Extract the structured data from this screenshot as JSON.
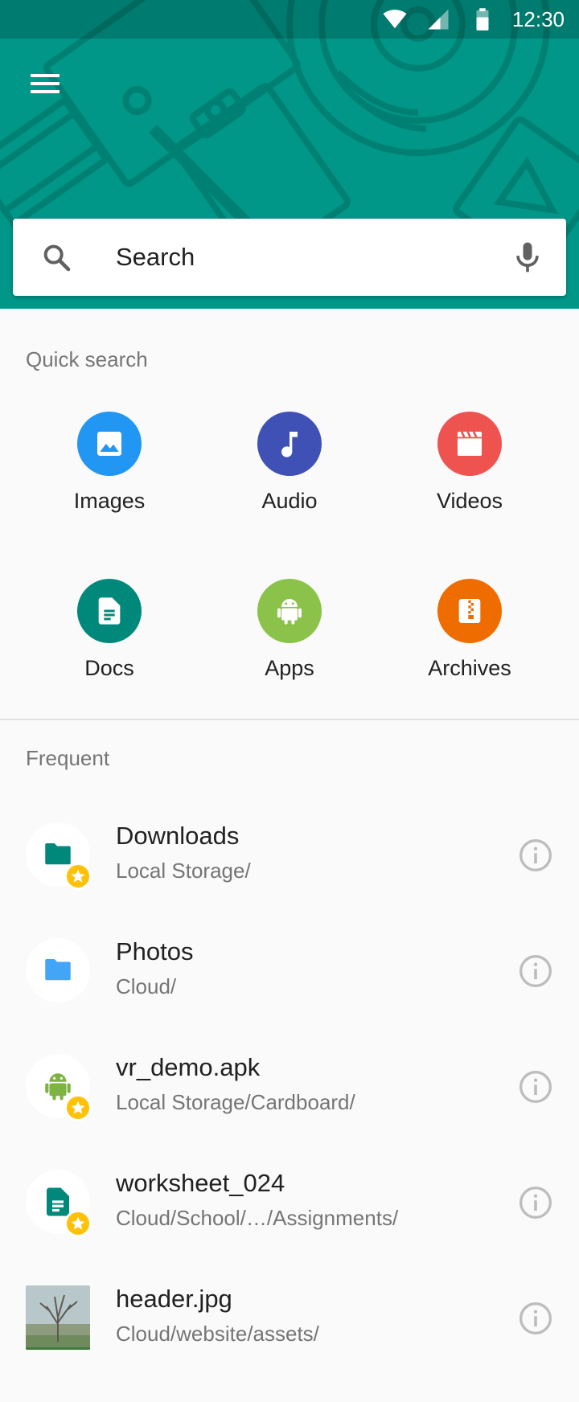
{
  "status_bar": {
    "time": "12:30",
    "icons": [
      "wifi-icon",
      "signal-icon",
      "battery-icon"
    ]
  },
  "header": {
    "menu_icon": "hamburger-menu-icon",
    "background_color": "#009688"
  },
  "search": {
    "placeholder": "Search",
    "search_icon": "search-icon",
    "mic_icon": "mic-icon"
  },
  "quick_search": {
    "label": "Quick search",
    "items": [
      {
        "label": "Images",
        "icon": "image-icon",
        "color": "#2196F3"
      },
      {
        "label": "Audio",
        "icon": "music-note-icon",
        "color": "#3F51B5"
      },
      {
        "label": "Videos",
        "icon": "movie-clapper-icon",
        "color": "#EF5350"
      },
      {
        "label": "Docs",
        "icon": "document-icon",
        "color": "#00897B"
      },
      {
        "label": "Apps",
        "icon": "android-icon",
        "color": "#8BC34A"
      },
      {
        "label": "Archives",
        "icon": "archive-zip-icon",
        "color": "#EF6C00"
      }
    ]
  },
  "frequent": {
    "label": "Frequent",
    "items": [
      {
        "name": "Downloads",
        "path": "Local Storage/",
        "icon": "folder-icon",
        "icon_color": "#00897B",
        "starred": true
      },
      {
        "name": "Photos",
        "path": "Cloud/",
        "icon": "folder-icon",
        "icon_color": "#42A5F5",
        "starred": false
      },
      {
        "name": "vr_demo.apk",
        "path": "Local Storage/Cardboard/",
        "icon": "android-icon",
        "icon_color": "#7CB342",
        "starred": true
      },
      {
        "name": "worksheet_024",
        "path": "Cloud/School/…/Assignments/",
        "icon": "document-icon",
        "icon_color": "#00897B",
        "starred": true
      },
      {
        "name": "header.jpg",
        "path": "Cloud/website/assets/",
        "icon": "image-thumbnail",
        "starred": false
      }
    ]
  }
}
